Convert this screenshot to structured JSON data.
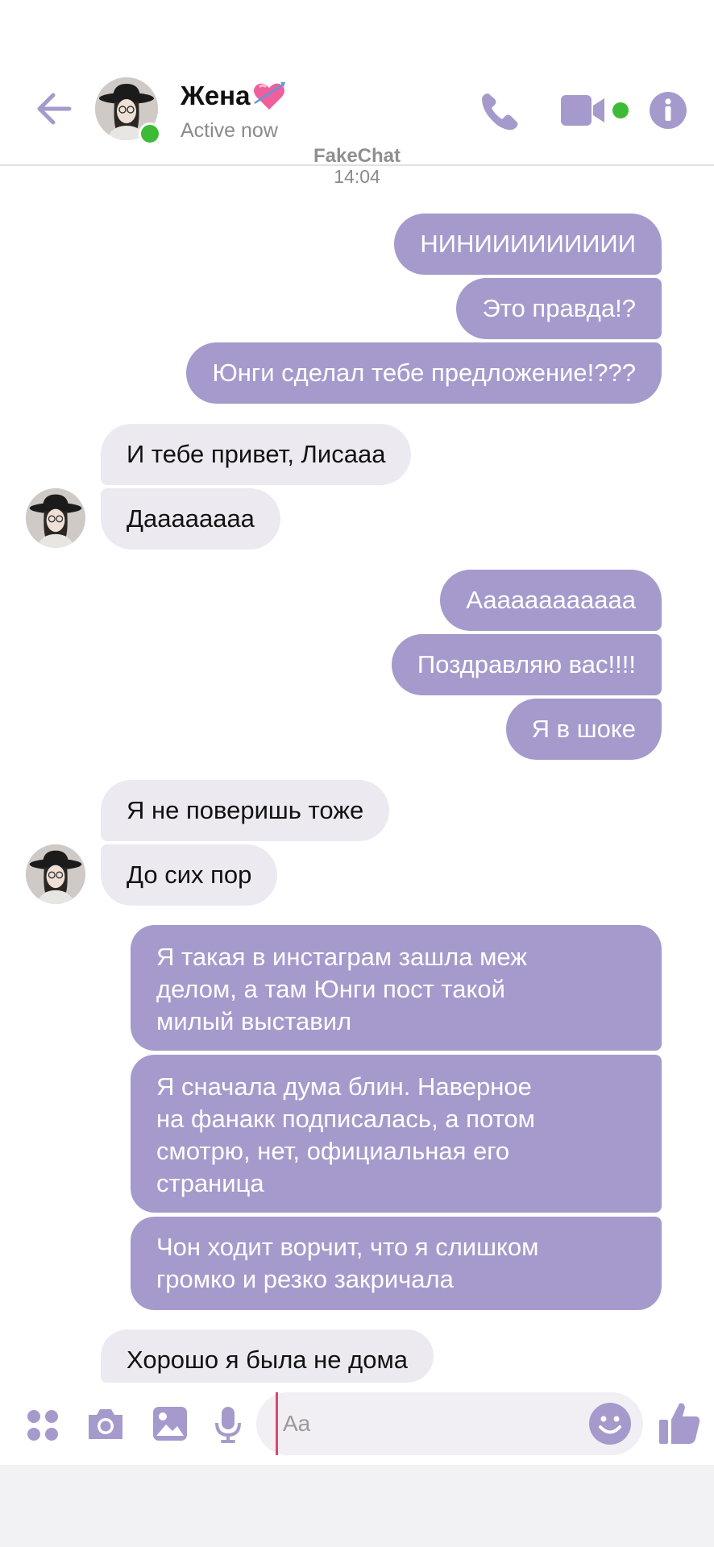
{
  "header": {
    "contact_name": "Жена",
    "status": "Active now"
  },
  "watermark": "FakeChat",
  "timestamp": "14:04",
  "messages": [
    {
      "dir": "out",
      "text": "НИНИИИИИИИИИ"
    },
    {
      "dir": "out",
      "text": "Это правда!?"
    },
    {
      "dir": "out",
      "text": "Юнги сделал тебе предложение!???"
    },
    {
      "dir": "in",
      "text": "И тебе привет, Лисааа"
    },
    {
      "dir": "in",
      "text": "Даааааааа"
    },
    {
      "dir": "out",
      "text": "Аааааааааааа"
    },
    {
      "dir": "out",
      "text": "Поздравляю вас!!!!"
    },
    {
      "dir": "out",
      "text": "Я в шоке"
    },
    {
      "dir": "in",
      "text": "Я не поверишь тоже"
    },
    {
      "dir": "in",
      "text": "До сих пор"
    },
    {
      "dir": "out",
      "text": "Я такая в инстаграм зашла меж\nделом, а там Юнги пост такой\nмилый выставил"
    },
    {
      "dir": "out",
      "text": "Я сначала дума блин. Наверное\nна фанакк подписалась, а потом\nсмотрю, нет, официальная его\nстраница"
    },
    {
      "dir": "out",
      "text": "Чон ходит ворчит, что я слишком\nгромко и резко закричала"
    },
    {
      "dir": "in",
      "text": "Хорошо я была не дома"
    }
  ],
  "composer": {
    "placeholder": "Aa"
  },
  "colors": {
    "accent": "#a69acc",
    "outgoing_bubble": "#a69acc",
    "incoming_bubble": "#eceaf0",
    "online": "#3dbb37"
  },
  "icons": [
    "back-arrow-icon",
    "phone-icon",
    "video-camera-icon",
    "info-icon",
    "heart-icon",
    "apps-icon",
    "camera-icon",
    "gallery-icon",
    "microphone-icon",
    "emoji-icon",
    "thumbs-up-icon"
  ]
}
